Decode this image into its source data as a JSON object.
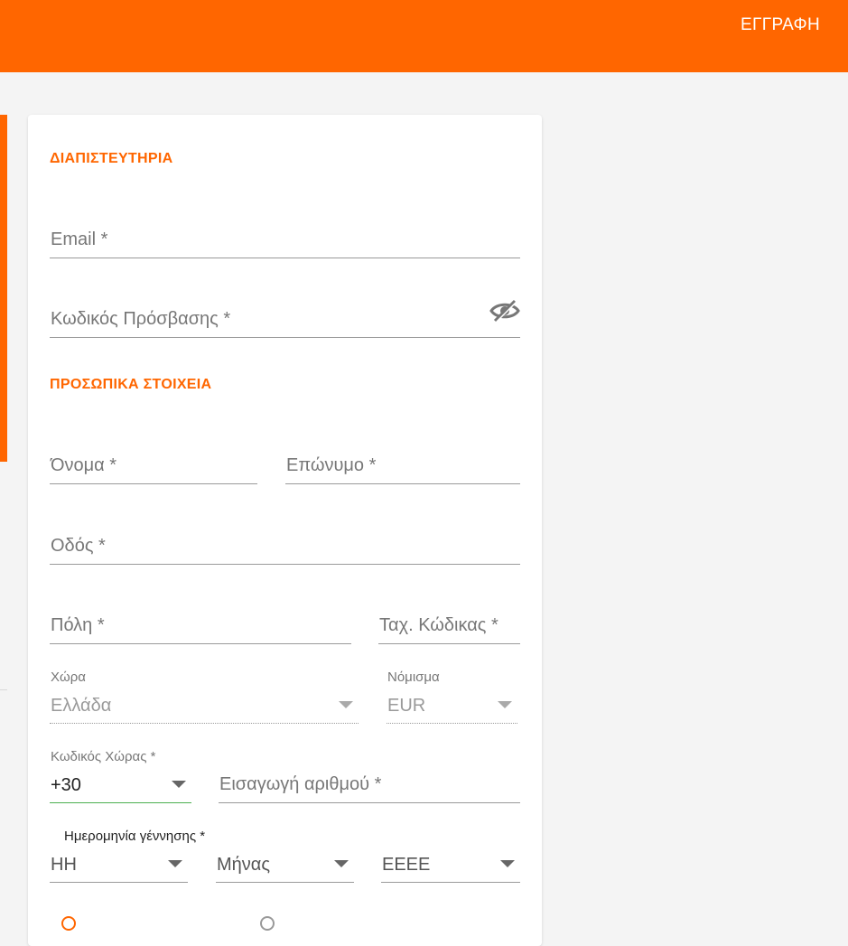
{
  "header": {
    "register_label": "ΕΓΓΡΑΦΗ"
  },
  "colors": {
    "accent": "#ff6600",
    "focus": "#4caf50"
  },
  "credentials": {
    "title": "ΔΙΑΠΙΣΤΕΥΤΗΡΙΑ",
    "email_placeholder": "Email *",
    "password_placeholder": "Κωδικός Πρόσβασης *",
    "password_toggle_icon": "eye-off-icon"
  },
  "personal": {
    "title": "ΠΡΟΣΩΠΙΚΑ ΣΤΟΙΧΕΙΑ",
    "first_name_placeholder": "Όνομα *",
    "last_name_placeholder": "Επώνυμο *",
    "street_placeholder": "Οδός *",
    "city_placeholder": "Πόλη *",
    "postal_placeholder": "Ταχ. Κώδικας *",
    "country_label": "Χώρα",
    "country_value": "Ελλάδα",
    "currency_label": "Νόμισμα",
    "currency_value": "EUR",
    "country_code_label": "Κωδικός Χώρας *",
    "country_code_value": "+30",
    "phone_placeholder": "Εισαγωγή αριθμού *",
    "dob_label": "Ημερομηνία γέννησης *",
    "dob_day": "ΗΗ",
    "dob_month": "Μήνας",
    "dob_year": "ΕΕΕΕ"
  }
}
